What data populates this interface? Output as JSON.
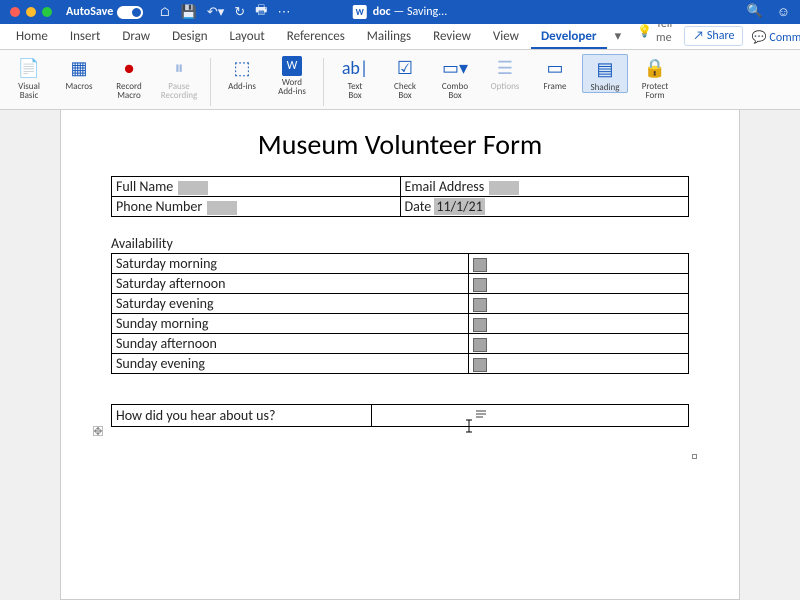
{
  "titlebar": {
    "autosave_label": "AutoSave",
    "autosave_state": "ON",
    "doc_name": "doc",
    "doc_status": "— Saving..."
  },
  "tabs": {
    "items": [
      "Home",
      "Insert",
      "Draw",
      "Design",
      "Layout",
      "References",
      "Mailings",
      "Review",
      "View",
      "Developer"
    ],
    "active": "Developer",
    "tellme": "Tell me",
    "share": "Share",
    "comments": "Comments"
  },
  "ribbon": {
    "visual_basic": "Visual\nBasic",
    "macros": "Macros",
    "record_macro": "Record\nMacro",
    "pause_recording": "Pause\nRecording",
    "addins": "Add-ins",
    "word_addins": "Word\nAdd-ins",
    "text_box": "Text\nBox",
    "check_box": "Check\nBox",
    "combo_box": "Combo\nBox",
    "options": "Options",
    "frame": "Frame",
    "shading": "Shading",
    "protect_form": "Protect\nForm"
  },
  "doc": {
    "title": "Museum Volunteer Form",
    "fields": {
      "full_name": "Full Name",
      "email": "Email Address",
      "phone": "Phone Number",
      "date_label": "Date",
      "date_value": "11/1/21"
    },
    "availability_label": "Availability",
    "availability": [
      "Saturday morning",
      "Saturday afternoon",
      "Saturday evening",
      "Sunday morning",
      "Sunday afternoon",
      "Sunday evening"
    ],
    "question": "How did you hear about us?"
  }
}
